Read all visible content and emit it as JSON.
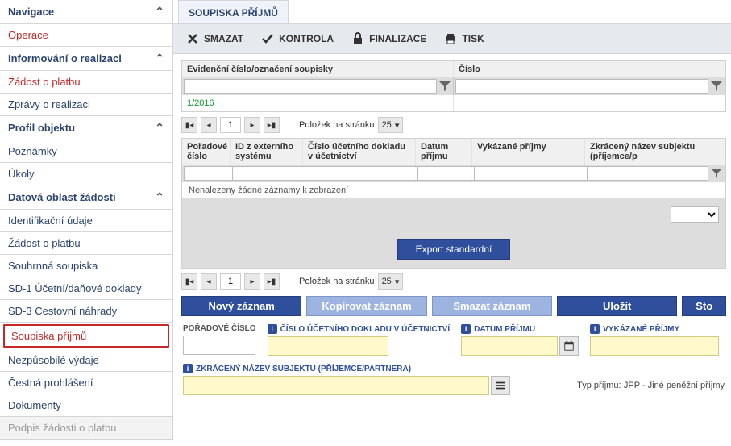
{
  "sidebar": {
    "items": [
      {
        "label": "Navigace",
        "header": true,
        "chev": true
      },
      {
        "label": "Operace",
        "red": true
      },
      {
        "label": "Informování o realizaci",
        "header": true,
        "chev": true
      },
      {
        "label": "Žádost o platbu",
        "red": true
      },
      {
        "label": "Zprávy o realizaci"
      },
      {
        "label": "Profil objektu",
        "header": true,
        "chev": true
      },
      {
        "label": "Poznámky"
      },
      {
        "label": "Úkoly"
      },
      {
        "label": "Datová oblast žádosti",
        "header": true,
        "chev": true
      },
      {
        "label": "Identifikační údaje"
      },
      {
        "label": "Žádost o platbu"
      },
      {
        "label": "Souhrnná soupiska"
      },
      {
        "label": "SD-1 Účetní/daňové doklady"
      },
      {
        "label": "SD-3 Cestovní náhrady"
      },
      {
        "label": "Soupiska příjmů",
        "active": true,
        "red": true
      },
      {
        "label": "Nezpůsobilé výdaje"
      },
      {
        "label": "Čestná prohlášení"
      },
      {
        "label": "Dokumenty"
      },
      {
        "label": "Podpis žádosti o platbu",
        "disabled": true
      }
    ]
  },
  "main": {
    "tab": "SOUPISKA PŘÍJMŮ",
    "toolbar": {
      "delete": "SMAZAT",
      "check": "KONTROLA",
      "finalize": "FINALIZACE",
      "print": "TISK"
    },
    "grid1": {
      "columns": [
        "Evidenční číslo/označení soupisky",
        "Číslo"
      ],
      "row": [
        "1/2016",
        ""
      ]
    },
    "pager": {
      "page": "1",
      "label": "Položek na stránku",
      "per_page": "25"
    },
    "grid2": {
      "columns": [
        "Pořadové číslo",
        "ID z externího systému",
        "Číslo účetního dokladu v účetnictví",
        "Datum příjmu",
        "Vykázané příjmy",
        "Zkrácený název subjektu (příjemce/p"
      ],
      "empty": "Nenalezeny žádné záznamy k zobrazení"
    },
    "export_btn": "Export standardní",
    "actions": {
      "new": "Nový záznam",
      "copy": "Kopírovat záznam",
      "del": "Smazat záznam",
      "save": "Uložit",
      "cancel": "Sto"
    },
    "form": {
      "poradove": {
        "label": "POŘADOVÉ ČÍSLO"
      },
      "cislo_doklad": {
        "label": "ČÍSLO ÚČETNÍHO DOKLADU V ÚČETNICTVÍ"
      },
      "datum": {
        "label": "DATUM PŘÍJMU"
      },
      "vykazane": {
        "label": "VYKÁZANÉ PŘÍJMY"
      },
      "zkraceny": {
        "label": "ZKRÁCENÝ NÁZEV SUBJEKTU (PŘÍJEMCE/PARTNERA)"
      },
      "typ": {
        "label": "Typ příjmu:",
        "value": "JPP - Jiné peněžní příjmy"
      }
    }
  }
}
